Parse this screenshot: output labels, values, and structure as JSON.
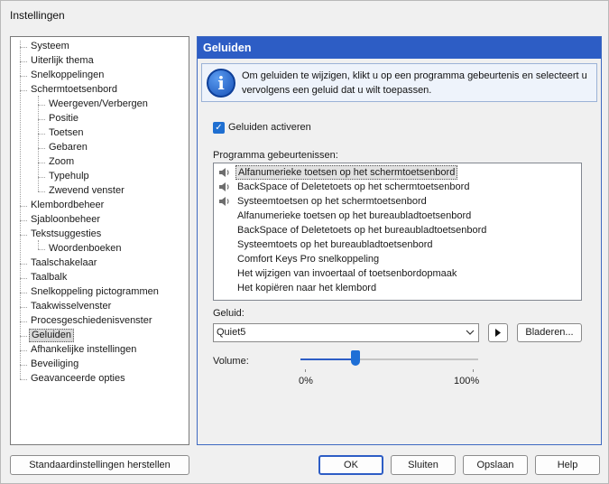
{
  "window": {
    "title": "Instellingen"
  },
  "tree": {
    "items": [
      {
        "label": "Systeem",
        "level": 0
      },
      {
        "label": "Uiterlijk thema",
        "level": 0
      },
      {
        "label": "Snelkoppelingen",
        "level": 0
      },
      {
        "label": "Schermtoetsenbord",
        "level": 0
      },
      {
        "label": "Weergeven/Verbergen",
        "level": 1
      },
      {
        "label": "Positie",
        "level": 1
      },
      {
        "label": "Toetsen",
        "level": 1
      },
      {
        "label": "Gebaren",
        "level": 1
      },
      {
        "label": "Zoom",
        "level": 1
      },
      {
        "label": "Typehulp",
        "level": 1
      },
      {
        "label": "Zwevend venster",
        "level": 1
      },
      {
        "label": "Klembordbeheer",
        "level": 0
      },
      {
        "label": "Sjabloonbeheer",
        "level": 0
      },
      {
        "label": "Tekstsuggesties",
        "level": 0
      },
      {
        "label": "Woordenboeken",
        "level": 1
      },
      {
        "label": "Taalschakelaar",
        "level": 0
      },
      {
        "label": "Taalbalk",
        "level": 0
      },
      {
        "label": "Snelkoppeling pictogrammen",
        "level": 0
      },
      {
        "label": "Taakwisselvenster",
        "level": 0
      },
      {
        "label": "Procesgeschiedenisvenster",
        "level": 0
      },
      {
        "label": "Geluiden",
        "level": 0,
        "selected": true
      },
      {
        "label": "Afhankelijke instellingen",
        "level": 0
      },
      {
        "label": "Beveiliging",
        "level": 0
      },
      {
        "label": "Geavanceerde opties",
        "level": 0
      }
    ]
  },
  "panel": {
    "title": "Geluiden",
    "info_icon": "info-icon",
    "info_line1": "Om geluiden te wijzigen, klikt u op een programma gebeurtenis en selecteert u",
    "info_line2": "vervolgens een geluid dat u wilt toepassen.",
    "enable_sounds_label": "Geluiden activeren",
    "enable_sounds_checked": true,
    "events_label": "Programma gebeurtenissen:",
    "events": [
      {
        "label": "Alfanumerieke toetsen op het schermtoetsenbord",
        "has_sound": true,
        "selected": true
      },
      {
        "label": "BackSpace of Deletetoets op het schermtoetsenbord",
        "has_sound": true
      },
      {
        "label": "Systeemtoetsen op het schermtoetsenbord",
        "has_sound": true
      },
      {
        "label": "Alfanumerieke toetsen op het bureaubladtoetsenbord",
        "has_sound": false
      },
      {
        "label": "BackSpace of Deletetoets op het bureaubladtoetsenbord",
        "has_sound": false
      },
      {
        "label": "Systeemtoets op het bureaubladtoetsenbord",
        "has_sound": false
      },
      {
        "label": "Comfort Keys Pro snelkoppeling",
        "has_sound": false
      },
      {
        "label": "Het wijzigen van invoertaal of toetsenbordopmaak",
        "has_sound": false
      },
      {
        "label": "Het kopiëren naar het klembord",
        "has_sound": false
      }
    ],
    "sound_label": "Geluid:",
    "sound_value": "Quiet5",
    "browse_label": "Bladeren...",
    "volume_label": "Volume:",
    "volume_value": 0.31,
    "volume_min_label": "0%",
    "volume_max_label": "100%"
  },
  "buttons": {
    "reset": "Standaardinstellingen herstellen",
    "ok": "OK",
    "close": "Sluiten",
    "save": "Opslaan",
    "help": "Help"
  },
  "colors": {
    "accent": "#2d5dc5",
    "panel_header": "#2d5dc5",
    "checkbox": "#1f6fd1"
  }
}
